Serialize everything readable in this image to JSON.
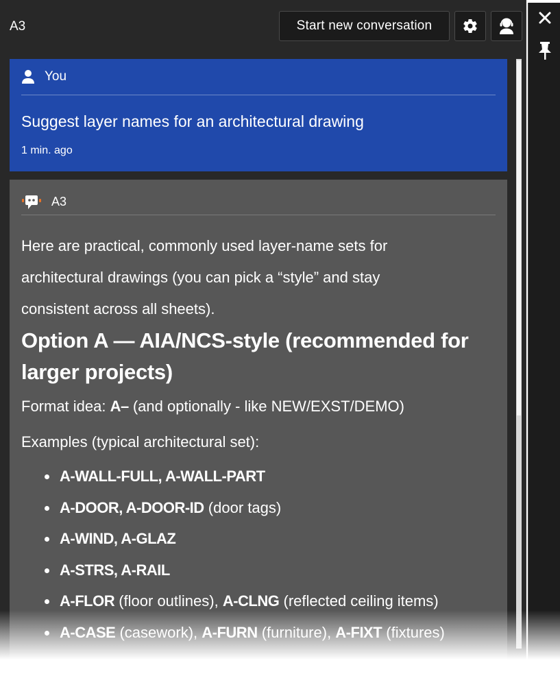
{
  "header": {
    "app_title": "A3",
    "new_conversation_label": "Start new conversation",
    "settings_icon": "gear-icon",
    "agent_icon": "agent-headset-icon"
  },
  "side_bar": {
    "close_icon": "close-icon",
    "pin_icon": "pin-icon"
  },
  "user_message": {
    "author": "You",
    "text": "Suggest layer names for an architectural drawing",
    "time": "1 min. ago"
  },
  "ai_message": {
    "author": "A3",
    "intro_1": "Here are practical, commonly used layer-name sets for",
    "intro_2": "architectural drawings (you can pick a “style” and stay",
    "intro_3": "consistent across all sheets).",
    "heading_1": "Option A — AIA/NCS-style (recommended for",
    "heading_2": "larger projects)",
    "format_label": "Format idea: ",
    "format_code": "A–",
    "format_rest": " (and optionally - like NEW/EXST/DEMO)",
    "examples_label": "Examples (typical architectural set):",
    "items": [
      {
        "bold": "A-WALL-FULL, A-WALL-PART",
        "rest": ""
      },
      {
        "bold": "A-DOOR, A-DOOR-ID",
        "rest": " (door tags)"
      },
      {
        "bold": "A-WIND, A-GLAZ",
        "rest": ""
      },
      {
        "bold": "A-STRS, A-RAIL",
        "rest": ""
      },
      {
        "bold": "A-FLOR",
        "rest": " (floor outlines), ",
        "bold2": "A-CLNG",
        "rest2": " (reflected ceiling items)"
      },
      {
        "bold": "A-CASE",
        "rest": " (casework), ",
        "bold2": "A-FURN",
        "rest2": " (furniture), ",
        "bold3": "A-FIXT",
        "rest3": " (fixtures)"
      }
    ]
  },
  "colors": {
    "panel_bg": "#282828",
    "user_bubble": "#2049ab",
    "ai_bubble": "#575757",
    "bot_icon_accent": "#e8742a"
  }
}
